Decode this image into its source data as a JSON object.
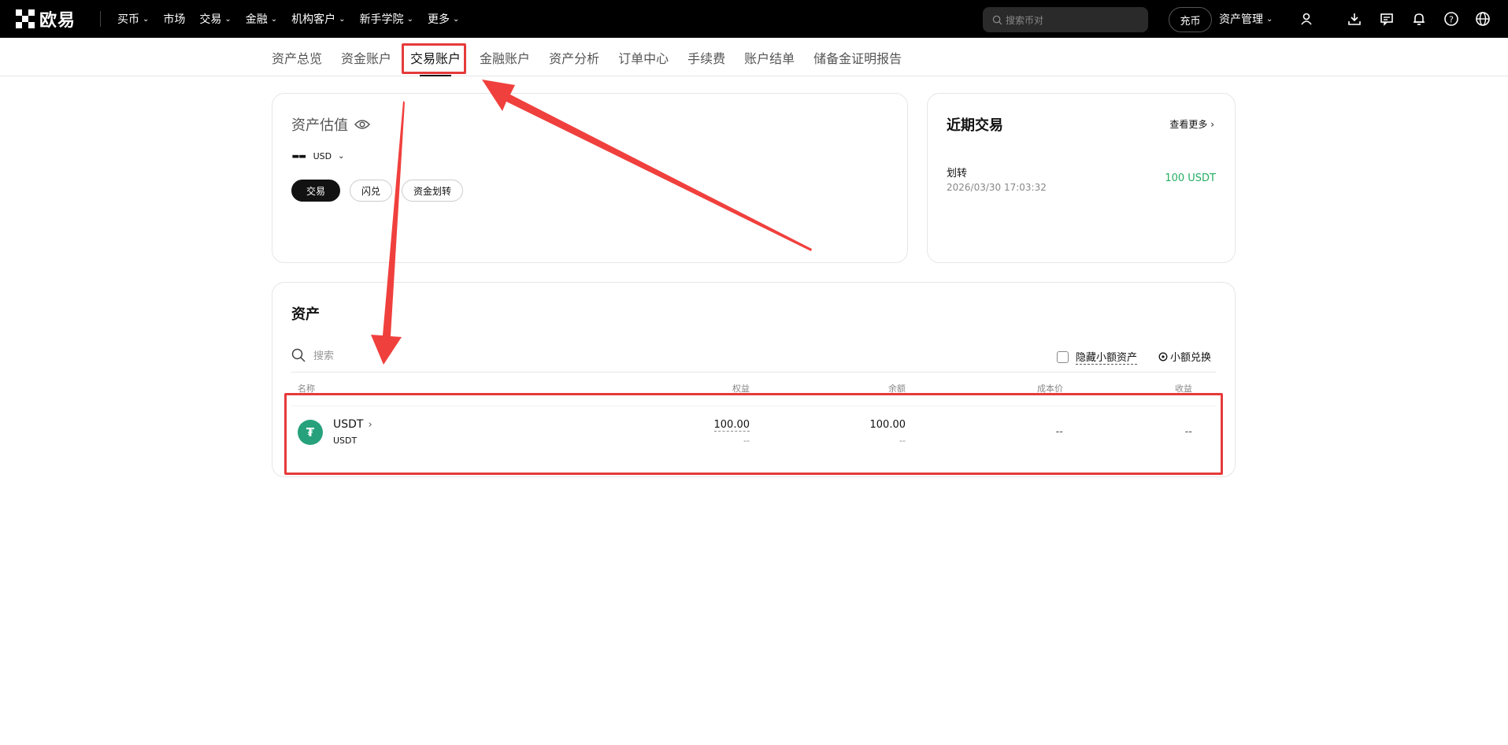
{
  "header": {
    "brand": "欧易",
    "nav": [
      {
        "label": "买币",
        "dropdown": true
      },
      {
        "label": "市场",
        "dropdown": false
      },
      {
        "label": "交易",
        "dropdown": true
      },
      {
        "label": "金融",
        "dropdown": true
      },
      {
        "label": "机构客户",
        "dropdown": true
      },
      {
        "label": "新手学院",
        "dropdown": true
      },
      {
        "label": "更多",
        "dropdown": true
      }
    ],
    "search_placeholder": "搜索币对",
    "deposit_label": "充币",
    "asset_mgmt_label": "资产管理",
    "icons": [
      "user-icon",
      "download-icon",
      "chat-icon",
      "bell-icon",
      "help-icon",
      "globe-icon"
    ]
  },
  "subnav": {
    "items": [
      "资产总览",
      "资金账户",
      "交易账户",
      "金融账户",
      "资产分析",
      "订单中心",
      "手续费",
      "账户结单",
      "储备金证明报告"
    ],
    "active_index": 2
  },
  "valuation": {
    "title": "资产估值",
    "amount": "--",
    "currency": "USD",
    "buttons": [
      "交易",
      "闪兑",
      "资金划转"
    ]
  },
  "recent": {
    "title": "近期交易",
    "see_more": "查看更多",
    "tx": {
      "name": "划转",
      "time": "2026/03/30 17:03:32",
      "amount": "100 USDT"
    }
  },
  "assets": {
    "title": "资产",
    "search_placeholder": "搜索",
    "hide_small_label": "隐藏小额资产",
    "small_exchange_label": "小额兑换",
    "columns": [
      "名称",
      "权益",
      "余额",
      "成本价",
      "收益"
    ],
    "rows": [
      {
        "coin": "USDT",
        "coin_sub": "USDT",
        "equity": "100.00",
        "equity_sub": "--",
        "balance": "100.00",
        "balance_sub": "--",
        "cost": "--",
        "pnl": "--"
      }
    ]
  },
  "colors": {
    "accent_green": "#24ae64",
    "highlight_red": "#e63a3a",
    "usdt_teal": "#26a17b"
  }
}
